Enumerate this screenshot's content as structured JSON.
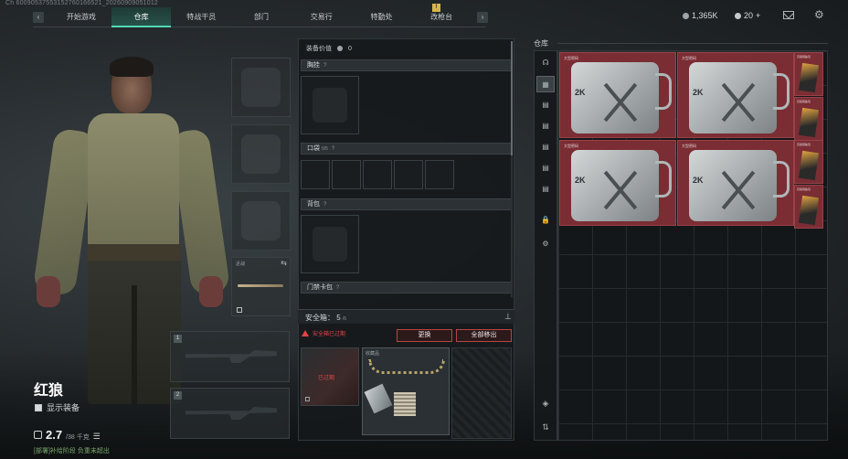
{
  "player_uid": "Ch 60090537553152760166521_20260909051012",
  "nav": {
    "tabs": [
      "开始游戏",
      "仓库",
      "特战干员",
      "部门",
      "交易行",
      "特勤处",
      "改枪台"
    ],
    "active_tab": "仓库",
    "notification": "!"
  },
  "currency": {
    "money": "1,365K",
    "count": "20",
    "count_plus": "+"
  },
  "operator": {
    "name": "红狼",
    "show_equipment_label": "显示装备",
    "weight": "2.7",
    "weight_max": "/38 千克",
    "status": "[部署]补给阶段 负重未超出"
  },
  "weapon_slots": [
    "1",
    "2"
  ],
  "knife_slot": {
    "label": "近战",
    "swap": "⇆"
  },
  "equipment": {
    "value_label": "装备价值",
    "value": "0",
    "chest_rig": "胸挂",
    "pockets": "口袋",
    "pockets_count": "0/5",
    "backpack": "背包",
    "keycard": "门禁卡包",
    "help": "?"
  },
  "safe_box": {
    "label": "安全箱：",
    "count": "5",
    "count_max": "/6",
    "warning": "安全箱已过期",
    "change_button": "更换",
    "remove_all_button": "全部移出",
    "expired_tag": "已过期",
    "item_b_label": "收藏品"
  },
  "warehouse": {
    "title": "仓库",
    "crate_label": "大型密码",
    "crate_number": "2K",
    "key_label": "高级钥匙包"
  }
}
